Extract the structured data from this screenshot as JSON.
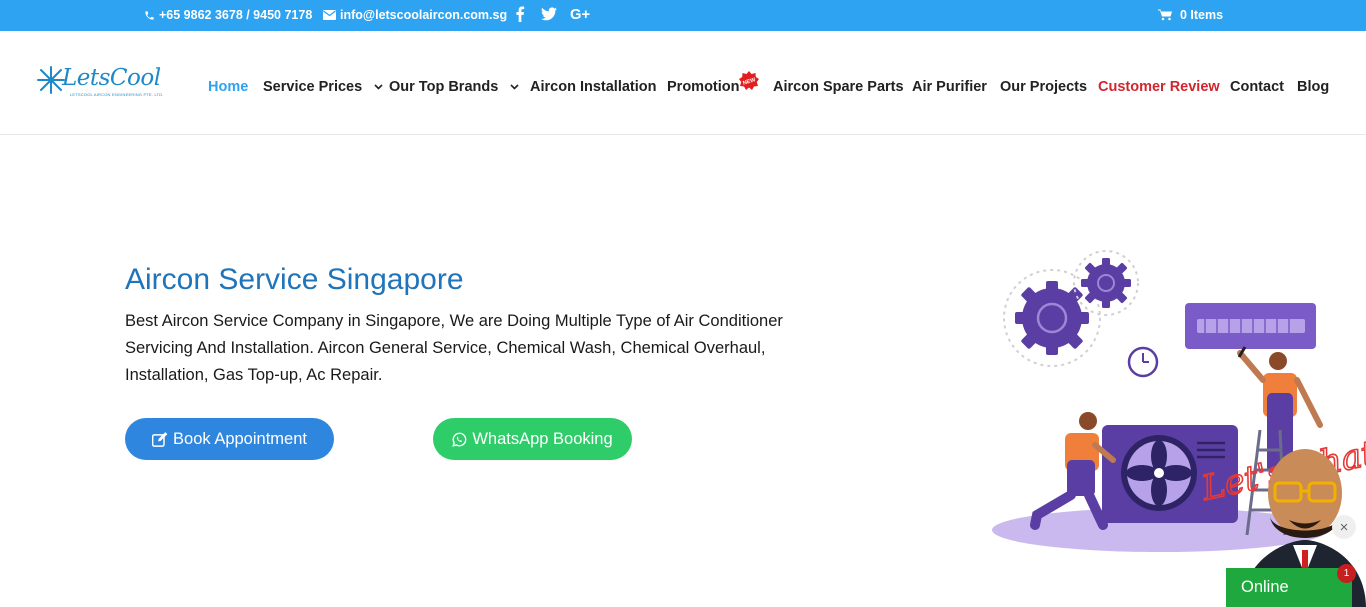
{
  "topbar": {
    "phone": "+65 9862 3678 / 9450 7178",
    "email": "info@letscoolaircon.com.sg",
    "cart": "0 Items",
    "bg_color": "#2ea3f2"
  },
  "logo": {
    "name": "LetsCool",
    "subtitle": "LETSCOOL AIRCON ENGINEERING PTE. LTD."
  },
  "nav": {
    "home": "Home",
    "service_prices": "Service Prices",
    "top_brands": "Our Top Brands",
    "installation": "Aircon Installation",
    "promotion": "Promotion",
    "new_badge": "NEW",
    "spare_parts": "Aircon Spare Parts",
    "air_purifier": "Air Purifier",
    "projects": "Our Projects",
    "customer_review": "Customer Review",
    "contact": "Contact",
    "blog": "Blog",
    "active_color": "#2ea3f2",
    "highlight_color": "#d0262e"
  },
  "hero": {
    "title": "Aircon Service Singapore",
    "description": "Best Aircon Service Company in Singapore, We are Doing Multiple Type of Air Conditioner Servicing  And Installation. Aircon General Service, Chemical Wash,  Chemical Overhaul, Installation, Gas Top-up, Ac Repair.",
    "book_button": "Book Appointment",
    "whatsapp_button": "WhatsApp Booking"
  },
  "chat": {
    "bubble_text": "Let's Chat",
    "status": "Online",
    "badge_count": "1",
    "close": "×"
  }
}
